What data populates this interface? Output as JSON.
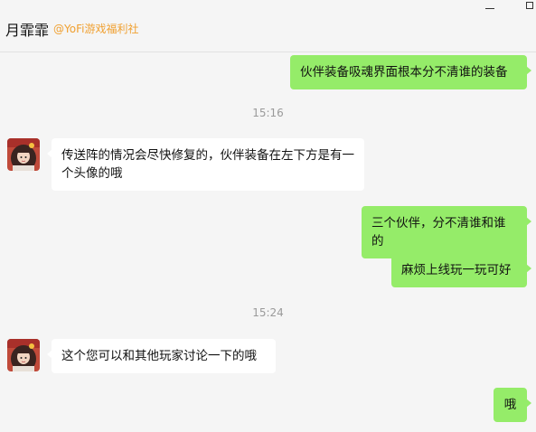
{
  "header": {
    "contact_name": "月霏霏",
    "contact_tag": "@YoFi游戏福利社"
  },
  "messages": [
    {
      "sender": "me",
      "text": "伙伴装备吸魂界面根本分不清谁的装备"
    },
    {
      "time": "15:16"
    },
    {
      "sender": "them",
      "text": "传送阵的情况会尽快修复的，伙伴装备在左下方是有一个头像的哦",
      "avatar": "anime-girl-avatar-icon"
    },
    {
      "sender": "me",
      "text": "三个伙伴，分不清谁和谁的"
    },
    {
      "sender": "me",
      "text": "麻烦上线玩一玩可好"
    },
    {
      "time": "15:24"
    },
    {
      "sender": "them",
      "text": "这个您可以和其他玩家讨论一下的哦",
      "avatar": "anime-girl-avatar-icon"
    },
    {
      "sender": "me",
      "text": "哦"
    }
  ],
  "colors": {
    "my_bubble": "#95ec69",
    "their_bubble": "#ffffff",
    "background": "#f5f5f5",
    "tag": "#f0a030",
    "timestamp": "#9a9a9a"
  }
}
